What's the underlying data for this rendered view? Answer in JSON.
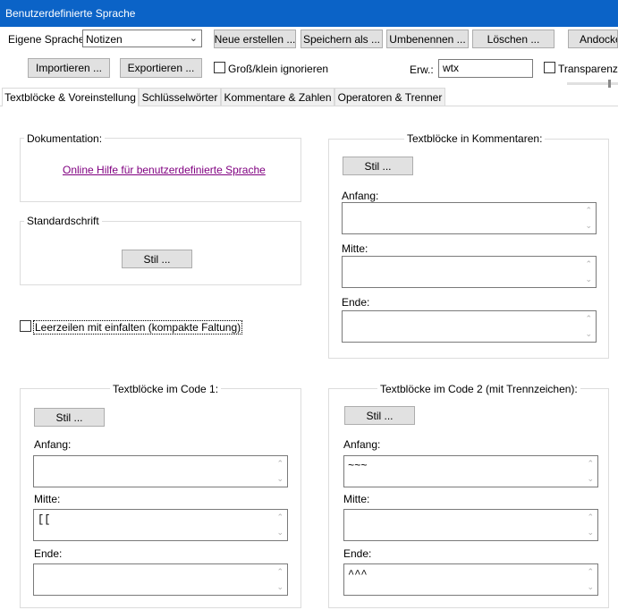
{
  "window": {
    "title": "Benutzerdefinierte Sprache"
  },
  "toolbar": {
    "language_label": "Eigene Sprache:",
    "language_value": "Notizen",
    "new_label": "Neue erstellen ...",
    "save_as_label": "Speichern als ...",
    "rename_label": "Umbenennen ...",
    "delete_label": "Löschen ...",
    "dock_label": "Andocken",
    "import_label": "Importieren ...",
    "export_label": "Exportieren ...",
    "ignore_case_label": "Groß/klein ignorieren",
    "ignore_case_checked": false,
    "ext_label": "Erw.:",
    "ext_value": "wtx",
    "transparency_label": "Transparenz",
    "transparency_checked": false
  },
  "tabs": [
    {
      "label": "Textblöcke & Voreinstellung",
      "active": true
    },
    {
      "label": "Schlüsselwörter",
      "active": false
    },
    {
      "label": "Kommentare & Zahlen",
      "active": false
    },
    {
      "label": "Operatoren & Trenner",
      "active": false
    }
  ],
  "documentation": {
    "title": "Dokumentation:",
    "link": "Online Hilfe für benutzerdefinierte Sprache"
  },
  "default_style": {
    "title": "Standardschrift",
    "style_label": "Stil ..."
  },
  "fold_empty": {
    "label": "Leerzeilen mit einfalten (kompakte Faltung)",
    "checked": false
  },
  "comment_blocks": {
    "title": "Textblöcke in Kommentaren:",
    "style_label": "Stil ...",
    "start_label": "Anfang:",
    "start_value": "",
    "middle_label": "Mitte:",
    "middle_value": "",
    "end_label": "Ende:",
    "end_value": ""
  },
  "code1_blocks": {
    "title": "Textblöcke im Code 1:",
    "style_label": "Stil ...",
    "start_label": "Anfang:",
    "start_value": "",
    "middle_label": "Mitte:",
    "middle_value": "[[",
    "end_label": "Ende:",
    "end_value": ""
  },
  "code2_blocks": {
    "title": "Textblöcke im Code 2 (mit Trennzeichen):",
    "style_label": "Stil ...",
    "start_label": "Anfang:",
    "start_value": "~~~",
    "middle_label": "Mitte:",
    "middle_value": "",
    "end_label": "Ende:",
    "end_value": "^^^"
  },
  "colors": {
    "titlebar": "#0b63c7",
    "link": "#800080"
  }
}
